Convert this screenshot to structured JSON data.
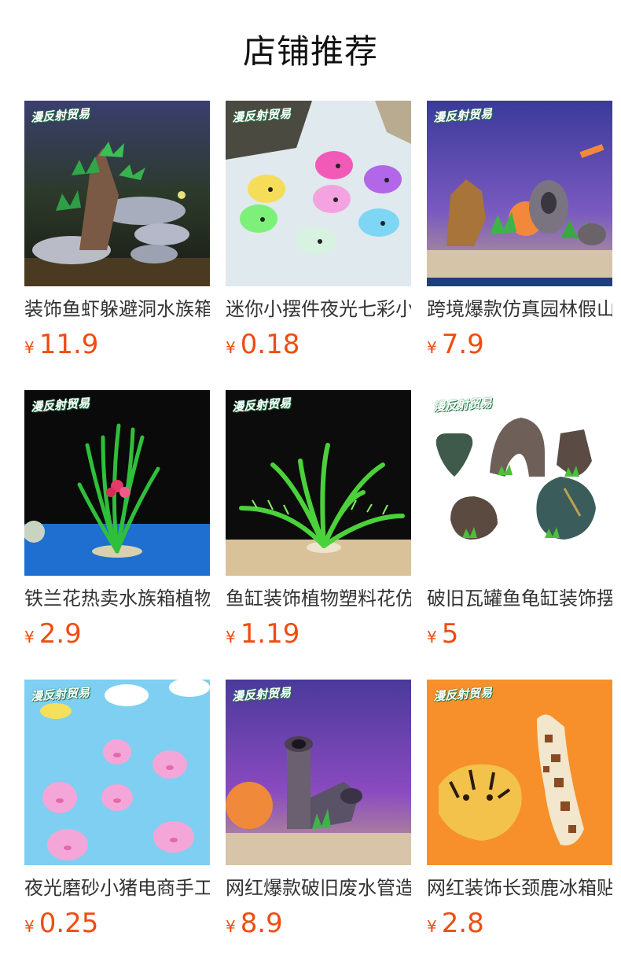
{
  "header": {
    "title": "店铺推荐"
  },
  "watermark": "漫反射贸易",
  "currency": "¥",
  "products": [
    {
      "name": "装饰鱼虾躲避洞水族箱造景假山",
      "price": "11.9",
      "thumb_icon": "aquarium-rock-ornament-icon"
    },
    {
      "name": "迷你小摆件夜光七彩小鲸鱼",
      "price": "0.18",
      "thumb_icon": "glow-whale-figurines-icon"
    },
    {
      "name": "跨境爆款仿真园林假山造景",
      "price": "7.9",
      "thumb_icon": "rockery-ornament-icon"
    },
    {
      "name": "铁兰花热卖水族箱植物装饰",
      "price": "2.9",
      "thumb_icon": "artificial-plant-icon"
    },
    {
      "name": "鱼缸装饰植物塑料花仿真水草",
      "price": "1.19",
      "thumb_icon": "artificial-fern-icon"
    },
    {
      "name": "破旧瓦罐鱼龟缸装饰摆件",
      "price": "5",
      "thumb_icon": "broken-pottery-ornaments-icon"
    },
    {
      "name": "夜光磨砂小猪电商手工摆件",
      "price": "0.25",
      "thumb_icon": "glow-pig-figurines-icon"
    },
    {
      "name": "网红爆款破旧废水管造景",
      "price": "8.9",
      "thumb_icon": "broken-pipe-ornament-icon"
    },
    {
      "name": "网红装饰长颈鹿冰箱贴摆件",
      "price": "2.8",
      "thumb_icon": "giraffe-tiger-figurine-icon"
    }
  ],
  "colors": {
    "price": "#ee4d10",
    "title": "#111111",
    "text": "#333333"
  }
}
